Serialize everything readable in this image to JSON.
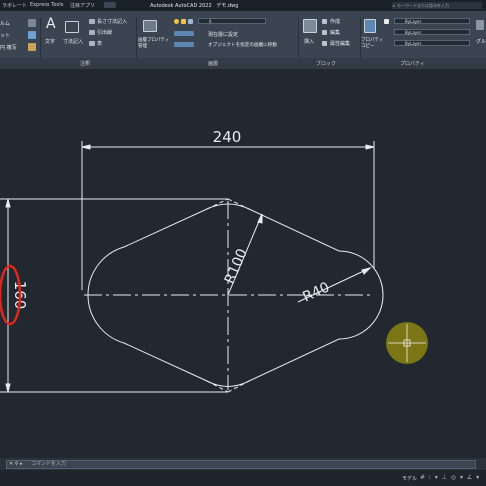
{
  "titlebar": {
    "tabs": [
      "ラボレート",
      "Express Tools",
      "注目アプリ"
    ],
    "app_title": "Autodesk AutoCAD 2022",
    "file_name": "デモ.dwg",
    "search_placeholder": "キーワードまたは語句を入力"
  },
  "ribbon": {
    "left_items": [
      "ルム",
      "ット",
      "円 複写"
    ],
    "text_label": "文字",
    "dimension_label": "寸法記入",
    "linear_dim_label": "長さ寸法記入",
    "leader_label": "引出線",
    "table_label": "表",
    "annotation_panel": "注釈",
    "layer_props_label": "画層プロパティ\n管理",
    "layer_name": "0",
    "layer_current_label": "現在層に設定",
    "match_layer_label": "オブジェクトを指定の画層に移動",
    "layers_panel": "画層",
    "insert_label": "挿入",
    "create_label": "作成",
    "edit_label": "編集",
    "edit_attr_label": "属性編集",
    "block_panel": "ブロック",
    "properties_label": "プロパティ\nコピー",
    "bylayer_1": "ByLayer",
    "bylayer_2": "ByLayer",
    "bylayer_3": "ByLayer",
    "properties_panel": "プロパティ",
    "group_label": "グル"
  },
  "drawing": {
    "dim_width": "240",
    "dim_height": "160",
    "radius_large": "R100",
    "radius_small": "R40"
  },
  "command_line": {
    "placeholder": "コマンドを入力"
  },
  "statusbar": {
    "model": "モデル",
    "icons": "# ⁝ ▾ ⊥ ◎ ▾ ∠ ▾"
  },
  "colors": {
    "canvas_bg": "#212830",
    "line": "#e8ecf0",
    "highlight_red": "#e0261a",
    "cursor_yellow": "#c8b400"
  }
}
